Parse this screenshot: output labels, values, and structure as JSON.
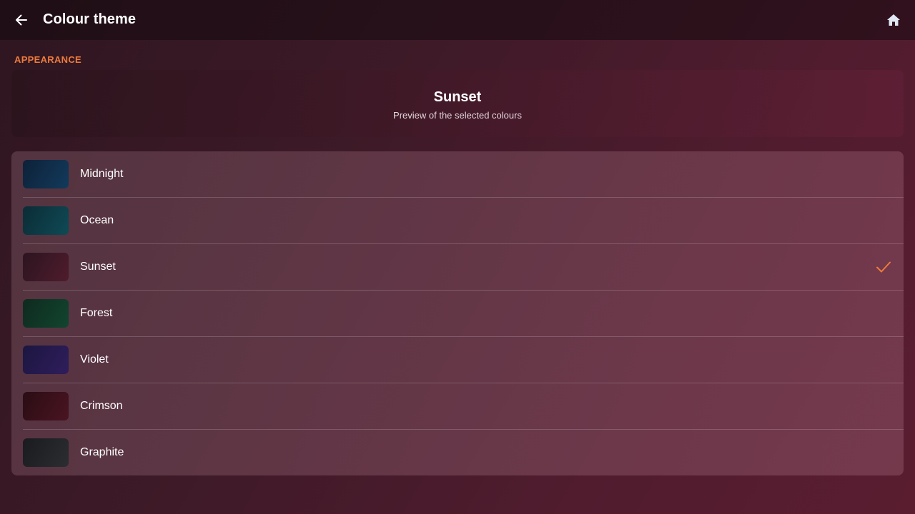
{
  "header": {
    "title": "Colour theme",
    "back_icon": "arrow-left-icon",
    "home_icon": "home-icon"
  },
  "section": {
    "label": "APPEARANCE"
  },
  "preview": {
    "title": "Sunset",
    "subtitle": "Preview of the selected colours"
  },
  "accent_color": "#ee7b3c",
  "themes": [
    {
      "name": "Midnight",
      "swatch_from": "#0d2138",
      "swatch_to": "#133a5c",
      "selected": false
    },
    {
      "name": "Ocean",
      "swatch_from": "#0b2c36",
      "swatch_to": "#0f4a55",
      "selected": false
    },
    {
      "name": "Sunset",
      "swatch_from": "#2c1420",
      "swatch_to": "#4f1c2c",
      "selected": true
    },
    {
      "name": "Forest",
      "swatch_from": "#0e2a1e",
      "swatch_to": "#124530",
      "selected": false
    },
    {
      "name": "Violet",
      "swatch_from": "#1c1640",
      "swatch_to": "#2f1d5c",
      "selected": false
    },
    {
      "name": "Crimson",
      "swatch_from": "#2a0d14",
      "swatch_to": "#4a1422",
      "selected": false
    },
    {
      "name": "Graphite",
      "swatch_from": "#1a1b1e",
      "swatch_to": "#2b2d31",
      "selected": false
    }
  ]
}
